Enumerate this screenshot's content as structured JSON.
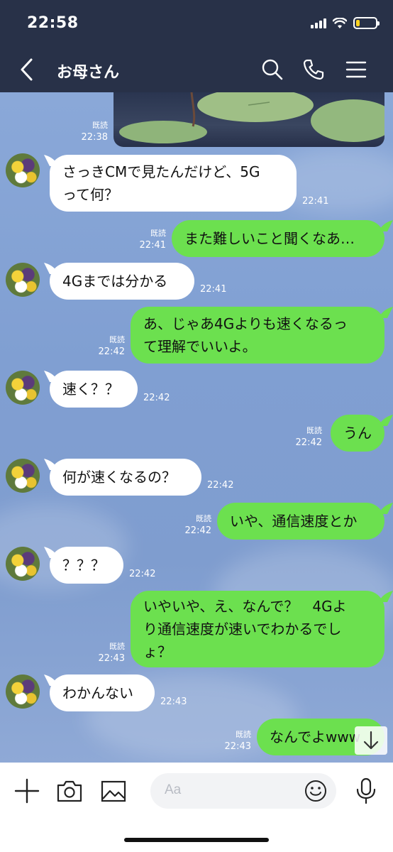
{
  "status_bar": {
    "time": "22:58"
  },
  "header": {
    "title": "お母さん",
    "icons": [
      "back-chevron-icon",
      "search-icon",
      "phone-icon",
      "menu-icon"
    ]
  },
  "photo_message": {
    "read": "既読",
    "time": "22:38"
  },
  "messages": [
    {
      "side": "in",
      "text": "さっきCMで見たんだけど、5G\nって何？",
      "time": "22:41"
    },
    {
      "side": "out",
      "text": "また難しいこと聞くなあ…",
      "read": "既読",
      "time": "22:41"
    },
    {
      "side": "in",
      "text": "4Gまでは分かる",
      "time": "22:41"
    },
    {
      "side": "out",
      "text": "あ、じゃあ4Gよりも速くなるっ\nて理解でいいよ。",
      "read": "既読",
      "time": "22:42"
    },
    {
      "side": "in",
      "text": "速く？？",
      "time": "22:42"
    },
    {
      "side": "out",
      "text": "うん",
      "read": "既読",
      "time": "22:42"
    },
    {
      "side": "in",
      "text": "何が速くなるの？",
      "time": "22:42"
    },
    {
      "side": "out",
      "text": "いや、通信速度とか",
      "read": "既読",
      "time": "22:42"
    },
    {
      "side": "in",
      "text": "？？？",
      "time": "22:42"
    },
    {
      "side": "out",
      "text": "いやいや、え、なんで？　4Gよ\nり通信速度が速いでわかるでし\nょ？",
      "read": "既読",
      "time": "22:43"
    },
    {
      "side": "in",
      "text": "わかんない",
      "time": "22:43"
    },
    {
      "side": "out",
      "text": "なんでよwww",
      "read": "既読",
      "time": "22:43"
    }
  ],
  "input": {
    "placeholder": "Aa"
  },
  "colors": {
    "header_bg": "#283148",
    "bubble_out": "#6ce04f",
    "bubble_in": "#ffffff",
    "chat_bg": "#7b9bcf"
  }
}
